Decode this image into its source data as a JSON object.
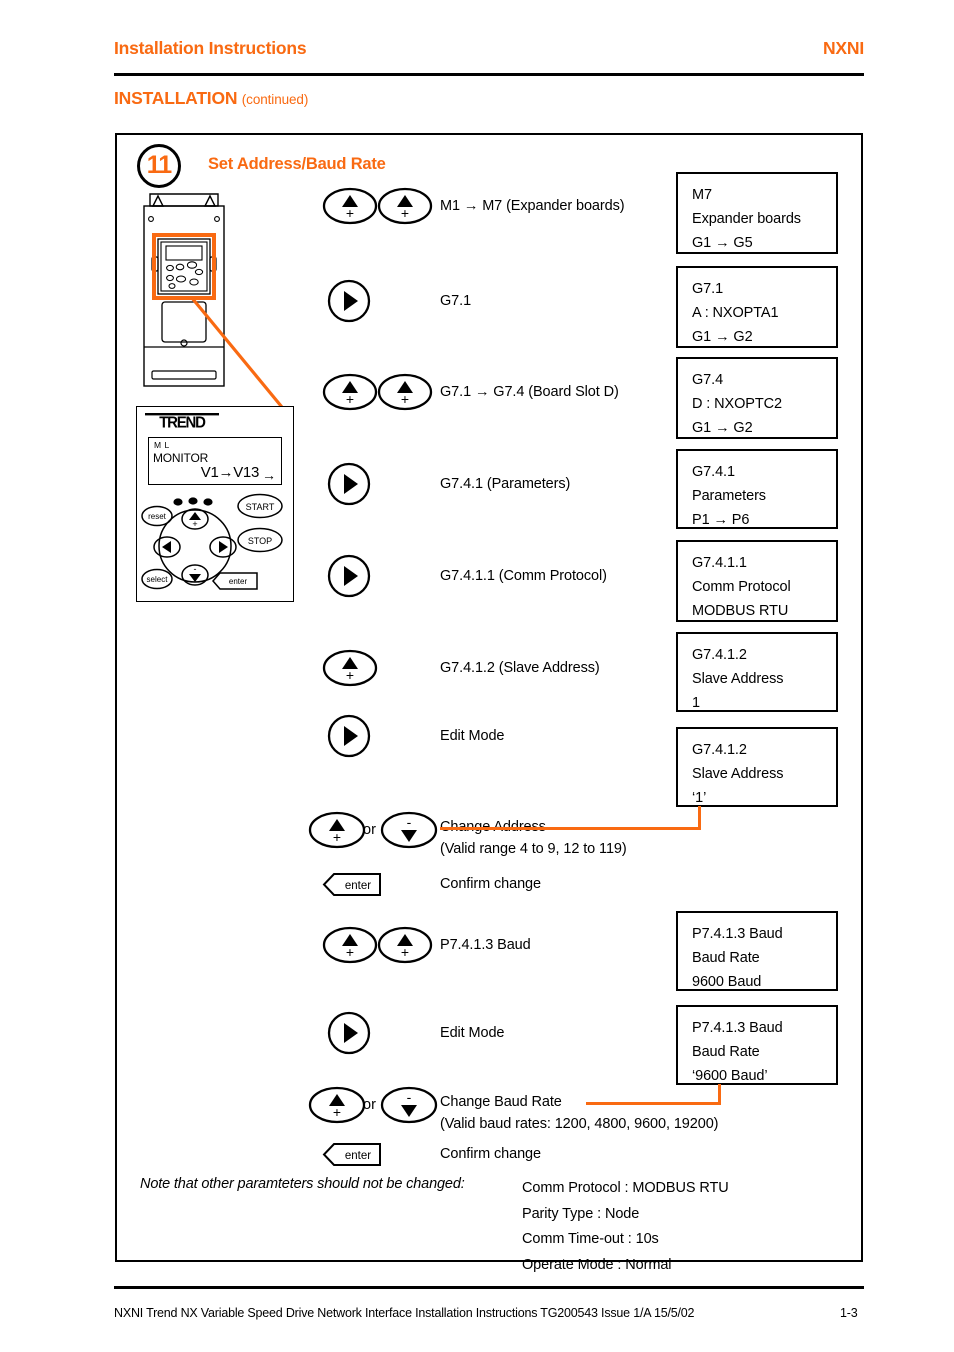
{
  "header": {
    "left": "Installation Instructions",
    "right": "NXNI",
    "section_title": "INSTALLATION",
    "section_continued": "(continued)"
  },
  "step": {
    "number": "11",
    "title": "Set Address/Baud Rate"
  },
  "keypad": {
    "logo": "TREND",
    "lcd_line1": "M L",
    "lcd_line2": "MONITOR",
    "lcd_line3": "V1→V13",
    "lcd_arrow": "→",
    "buttons": {
      "reset": "reset",
      "start": "START",
      "stop": "STOP",
      "select": "select",
      "enter": "enter",
      "up": "+",
      "down": "-"
    }
  },
  "rows": [
    {
      "id": "row-m1-m7",
      "keys": "up,up",
      "label": "M1 → M7 (Expander boards)",
      "sub": ""
    },
    {
      "id": "row-g71",
      "keys": "right",
      "label": "G7.1",
      "sub": ""
    },
    {
      "id": "row-g71-g74",
      "keys": "up,up",
      "label": "G7.1 → G7.4 (Board Slot D)",
      "sub": ""
    },
    {
      "id": "row-g741",
      "keys": "right",
      "label": "G7.4.1 (Parameters)",
      "sub": ""
    },
    {
      "id": "row-g7411",
      "keys": "right",
      "label": "G7.4.1.1 (Comm Protocol)",
      "sub": ""
    },
    {
      "id": "row-g7412",
      "keys": "up",
      "label": "G7.4.1.2 (Slave Address)",
      "sub": ""
    },
    {
      "id": "row-edit-addr",
      "keys": "right",
      "label": "Edit Mode",
      "sub": ""
    },
    {
      "id": "row-change-addr",
      "keys": "up,or,down",
      "label": "Change Address",
      "sub": "(Valid range 4 to 9, 12 to 119)"
    },
    {
      "id": "row-confirm-addr",
      "keys": "enter",
      "label": "Confirm change",
      "sub": ""
    },
    {
      "id": "row-p7413",
      "keys": "up,up",
      "label": "P7.4.1.3 Baud",
      "sub": ""
    },
    {
      "id": "row-edit-baud",
      "keys": "right",
      "label": "Edit Mode",
      "sub": ""
    },
    {
      "id": "row-change-baud",
      "keys": "up,or,down",
      "label": "Change Baud Rate",
      "sub": "(Valid baud rates: 1200, 4800, 9600, 19200)"
    },
    {
      "id": "row-confirm-baud",
      "keys": "enter",
      "label": "Confirm change",
      "sub": ""
    }
  ],
  "or_label": "or",
  "displays": [
    {
      "id": "disp-m7",
      "l1": "M7",
      "l2": "Expander boards",
      "l3": "G1 → G5"
    },
    {
      "id": "disp-g71",
      "l1": "G7.1",
      "l2": "A : NXOPTA1",
      "l3": "G1 → G2"
    },
    {
      "id": "disp-g74",
      "l1": "G7.4",
      "l2": "D : NXOPTC2",
      "l3": "G1 → G2"
    },
    {
      "id": "disp-g741",
      "l1": "G7.4.1",
      "l2": "Parameters",
      "l3": "P1 → P6"
    },
    {
      "id": "disp-g7411",
      "l1": "G7.4.1.1",
      "l2": "Comm Protocol",
      "l3": "MODBUS RTU"
    },
    {
      "id": "disp-g7412",
      "l1": "G7.4.1.2",
      "l2": "Slave Address",
      "l3": "1"
    },
    {
      "id": "disp-g7412e",
      "l1": "G7.4.1.2",
      "l2": "Slave Address",
      "l3": "‘1’"
    },
    {
      "id": "disp-baud",
      "l1": "P7.4.1.3 Baud",
      "l2": "Baud Rate",
      "l3": "9600 Baud"
    },
    {
      "id": "disp-baude",
      "l1": "P7.4.1.3 Baud",
      "l2": "Baud Rate",
      "l3": "‘9600 Baud’"
    }
  ],
  "note": {
    "text": "Note that other paramteters should not be changed:",
    "items": [
      "Comm Protocol : MODBUS RTU",
      "Parity Type : Node",
      "Comm Time-out : 10s",
      "Operate Mode : Normal"
    ]
  },
  "footer": {
    "text": "NXNI Trend NX Variable Speed Drive Network Interface Installation Instructions TG200543 Issue 1/A 15/5/02",
    "page": "1-3"
  },
  "colors": {
    "accent": "#F96A12",
    "ink": "#000000",
    "paper": "#FFFFFF"
  }
}
